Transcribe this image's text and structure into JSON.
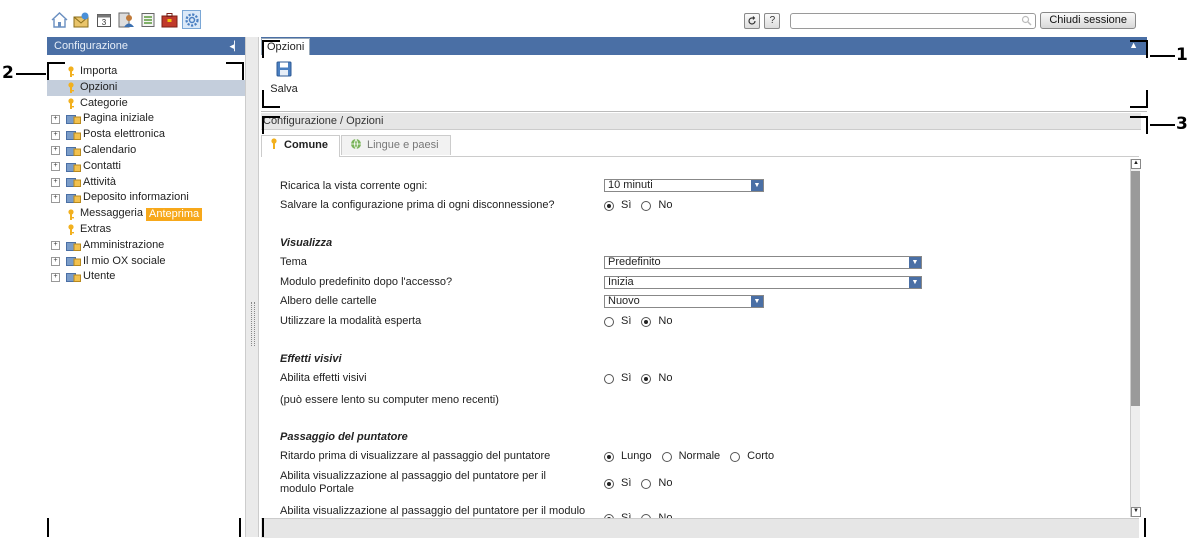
{
  "toolbar": {
    "icons": [
      "home-icon",
      "mail-icon",
      "calendar-icon",
      "contacts-icon",
      "tasks-icon",
      "infostore-icon",
      "config-icon"
    ],
    "selected_icon": "config-icon",
    "logout_label": "Chiudi sessione",
    "search_placeholder": ""
  },
  "sidebar": {
    "title": "Configurazione",
    "items": [
      {
        "label": "Importa",
        "icon": "key",
        "expandable": false,
        "selected": false
      },
      {
        "label": "Opzioni",
        "icon": "key",
        "expandable": false,
        "selected": true
      },
      {
        "label": "Categorie",
        "icon": "key",
        "expandable": false,
        "selected": false
      },
      {
        "label": "Pagina iniziale",
        "icon": "folder",
        "expandable": true,
        "selected": false
      },
      {
        "label": "Posta elettronica",
        "icon": "folder",
        "expandable": true,
        "selected": false
      },
      {
        "label": "Calendario",
        "icon": "folder",
        "expandable": true,
        "selected": false
      },
      {
        "label": "Contatti",
        "icon": "folder",
        "expandable": true,
        "selected": false
      },
      {
        "label": "Attività",
        "icon": "folder",
        "expandable": true,
        "selected": false
      },
      {
        "label": "Deposito informazioni",
        "icon": "folder",
        "expandable": true,
        "selected": false
      },
      {
        "label": "Messaggeria",
        "icon": "key",
        "expandable": false,
        "selected": false,
        "badge": "Anteprima"
      },
      {
        "label": "Extras",
        "icon": "key",
        "expandable": false,
        "selected": false
      },
      {
        "label": "Amministrazione",
        "icon": "folder",
        "expandable": true,
        "selected": false
      },
      {
        "label": "Il mio OX sociale",
        "icon": "folder",
        "expandable": true,
        "selected": false
      },
      {
        "label": "Utente",
        "icon": "folder",
        "expandable": true,
        "selected": false
      }
    ]
  },
  "panel": {
    "tab": "Opzioni",
    "save_label": "Salva",
    "breadcrumb": "Configurazione / Opzioni",
    "tabs": [
      {
        "label": "Comune",
        "active": true
      },
      {
        "label": "Lingue e paesi",
        "active": false
      }
    ]
  },
  "form": {
    "refresh_label": "Ricarica la vista corrente ogni:",
    "refresh_value": "10 minuti",
    "save_conf_label": "Salvare la configurazione prima di ogni disconnessione?",
    "yes": "Sì",
    "no": "No",
    "section_view": "Visualizza",
    "theme_label": "Tema",
    "theme_value": "Predefinito",
    "default_module_label": "Modulo predefinito dopo l'accesso?",
    "default_module_value": "Inizia",
    "folder_tree_label": "Albero delle cartelle",
    "folder_tree_value": "Nuovo",
    "expert_label": "Utilizzare la modalità esperta",
    "section_effects": "Effetti visivi",
    "effects_label": "Abilita effetti visivi",
    "effects_note": "(può essere lento su computer meno recenti)",
    "section_hover": "Passaggio del puntatore",
    "hover_delay_label": "Ritardo prima di visualizzare al passaggio del puntatore",
    "hover_long": "Lungo",
    "hover_normal": "Normale",
    "hover_short": "Corto",
    "hover_portal_label": "Abilita visualizzazione al passaggio del puntatore per il modulo Portale",
    "hover_module_label": "Abilita visualizzazione al passaggio del puntatore per il modulo"
  },
  "radio_state": {
    "save_conf": "yes",
    "expert": "no",
    "effects": "no",
    "hover_delay": "long",
    "hover_portal": "yes"
  },
  "callouts": [
    "1",
    "2",
    "3"
  ]
}
